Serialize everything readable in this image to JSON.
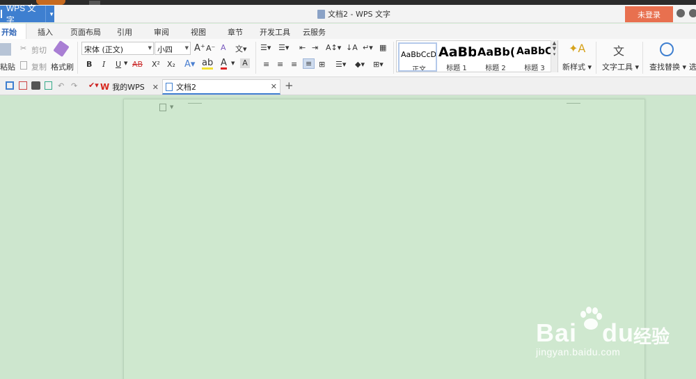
{
  "titlebar": {
    "app_menu_label": "WPS 文字",
    "document_title": "文档2 - WPS 文字",
    "login_label": "未登录"
  },
  "tabs": [
    "开始",
    "插入",
    "页面布局",
    "引用",
    "审阅",
    "视图",
    "章节",
    "开发工具",
    "云服务"
  ],
  "ribbon": {
    "paste": "粘贴",
    "cut": "剪切",
    "copy": "复制",
    "format_painter": "格式刷",
    "font_name": "宋体 (正文)",
    "font_size": "小四",
    "bold": "B",
    "italic": "I",
    "underline": "U",
    "strikethrough": "AB",
    "superscript": "X²",
    "subscript": "X₂",
    "styles": [
      {
        "preview": "AaBbCcDd",
        "label": "正文"
      },
      {
        "preview": "AaBb",
        "label": "标题 1"
      },
      {
        "preview": "AaBb(",
        "label": "标题 2"
      },
      {
        "preview": "AaBbC",
        "label": "标题 3"
      }
    ],
    "new_style": "新样式",
    "text_tools": "文字工具",
    "find_replace": "查找替换",
    "select_partial": "选"
  },
  "doc_tabs": [
    {
      "label": "我的WPS"
    },
    {
      "label": "文档2"
    }
  ],
  "watermark": {
    "brand": "Bai",
    "brand2": "du",
    "jingyan": "经验",
    "url": "jingyan.baidu.com"
  },
  "colors": {
    "accent": "#3e7fd0",
    "login": "#e8704f",
    "workspace": "#cde6ce"
  }
}
